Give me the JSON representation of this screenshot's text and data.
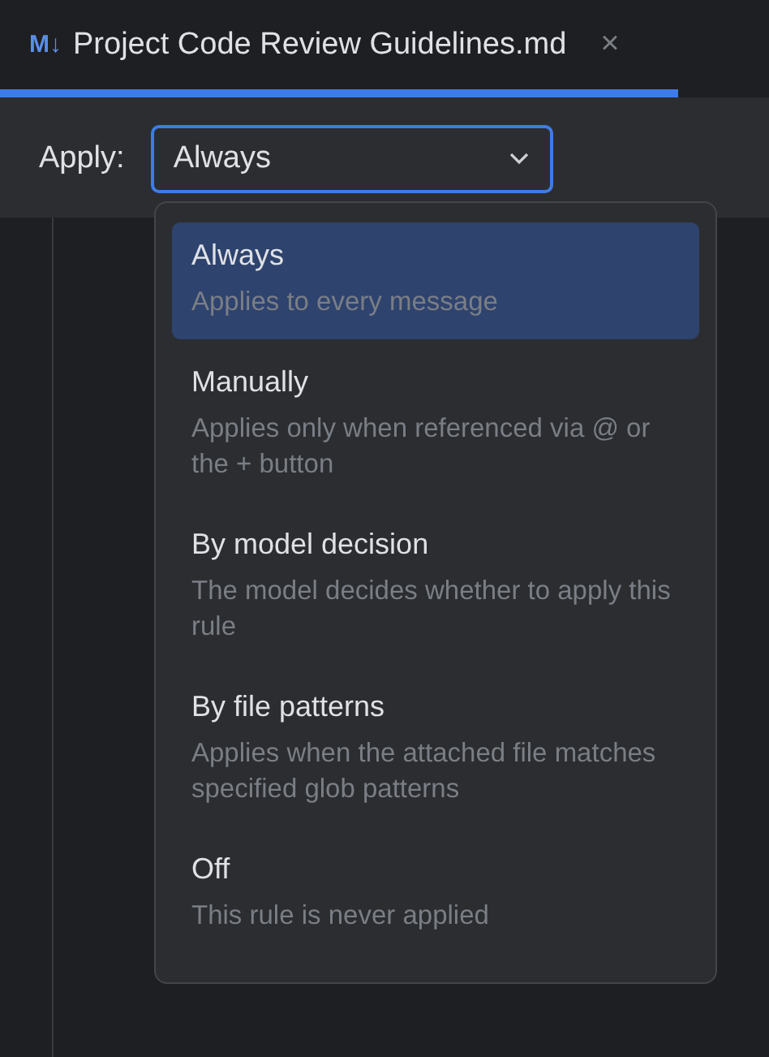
{
  "tab": {
    "icon_text": "M↓",
    "title": "Project Code Review Guidelines.md",
    "close": "×",
    "selected": true
  },
  "apply": {
    "label": "Apply:",
    "value": "Always",
    "expanded": true
  },
  "options": [
    {
      "title": "Always",
      "description": "Applies to every message",
      "selected": true
    },
    {
      "title": "Manually",
      "description": "Applies only when referenced via @ or the + button",
      "selected": false
    },
    {
      "title": "By model decision",
      "description": "The model decides whether to apply this rule",
      "selected": false
    },
    {
      "title": "By file patterns",
      "description": "Applies when the attached file matches specified glob patterns",
      "selected": false
    },
    {
      "title": "Off",
      "description": "This rule is never applied",
      "selected": false
    }
  ]
}
